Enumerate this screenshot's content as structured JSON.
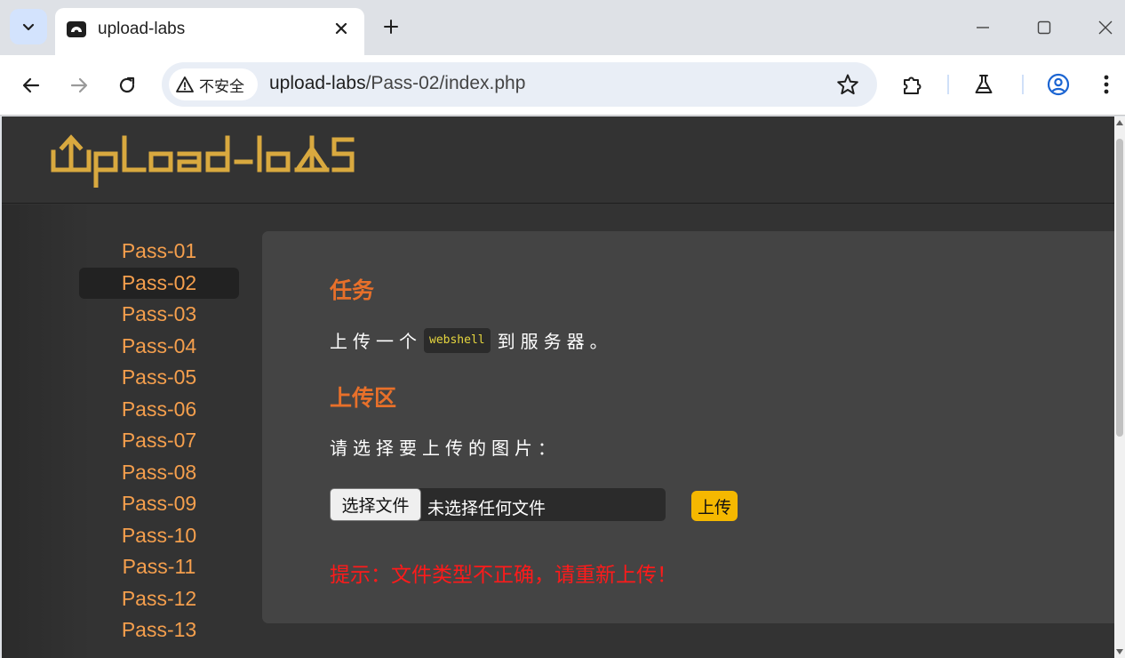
{
  "browser": {
    "tab_title": "upload-labs",
    "security_label": "不安全",
    "url_host": "upload-labs",
    "url_path": "/Pass-02/index.php",
    "accent_color": "#d3e3fd"
  },
  "site": {
    "logo_text": "Upload-labs",
    "logo_color": "#d9a93f"
  },
  "sidebar": {
    "items": [
      {
        "label": "Pass-01",
        "active": false
      },
      {
        "label": "Pass-02",
        "active": true
      },
      {
        "label": "Pass-03",
        "active": false
      },
      {
        "label": "Pass-04",
        "active": false
      },
      {
        "label": "Pass-05",
        "active": false
      },
      {
        "label": "Pass-06",
        "active": false
      },
      {
        "label": "Pass-07",
        "active": false
      },
      {
        "label": "Pass-08",
        "active": false
      },
      {
        "label": "Pass-09",
        "active": false
      },
      {
        "label": "Pass-10",
        "active": false
      },
      {
        "label": "Pass-11",
        "active": false
      },
      {
        "label": "Pass-12",
        "active": false
      },
      {
        "label": "Pass-13",
        "active": false
      }
    ]
  },
  "main": {
    "task_heading": "任务",
    "task_prefix": "上传一个",
    "task_code": "webshell",
    "task_suffix": "到服务器。",
    "upload_heading": "上传区",
    "choose_prompt": "请选择要上传的图片：",
    "file_button": "选择文件",
    "file_status": "未选择任何文件",
    "upload_button": "上传",
    "hint": "提示：文件类型不正确，请重新上传！",
    "heading_color": "#e8702a",
    "hint_color": "#ff1a1a"
  }
}
